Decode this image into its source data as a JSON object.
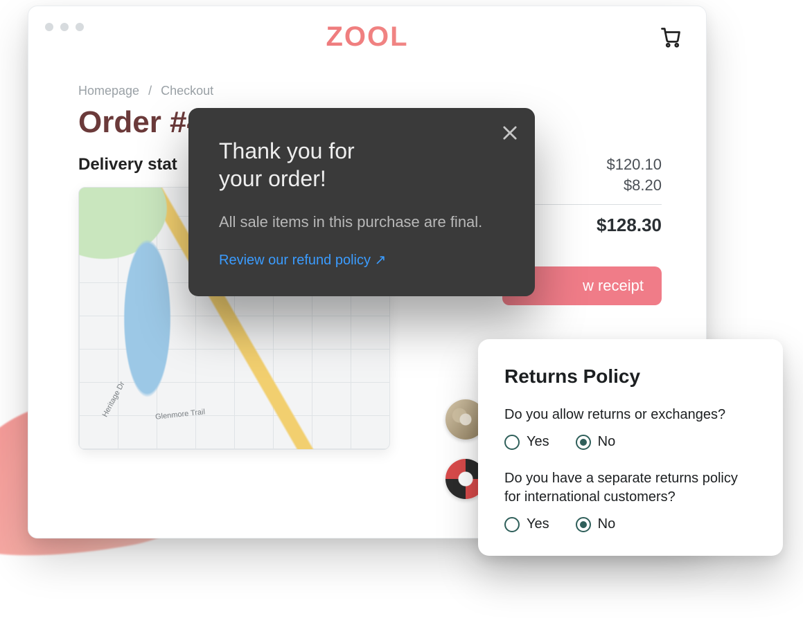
{
  "brand": "ZOOL",
  "breadcrumb": {
    "home": "Homepage",
    "current": "Checkout"
  },
  "page_title": "Order #4",
  "delivery_label": "Delivery stat",
  "map": {
    "road_labels": {
      "glenmore": "Glenmore Trail",
      "heritage": "Heritage Dr"
    }
  },
  "totals": {
    "subtotal": "$120.10",
    "shipping": "$8.20",
    "grand": "$128.30"
  },
  "receipt_button": "w receipt",
  "modal": {
    "title_line1": "Thank you for",
    "title_line2": "your order!",
    "body": "All sale items in this purchase are final.",
    "link": "Review our refund policy",
    "link_arrow": "↗",
    "close": "×"
  },
  "policy": {
    "title": "Returns Policy",
    "q1": "Do you allow returns or exchanges?",
    "q2": "Do you have a separate returns policy for international customers?",
    "yes": "Yes",
    "no": "No",
    "q1_answer": "No",
    "q2_answer": "No"
  }
}
